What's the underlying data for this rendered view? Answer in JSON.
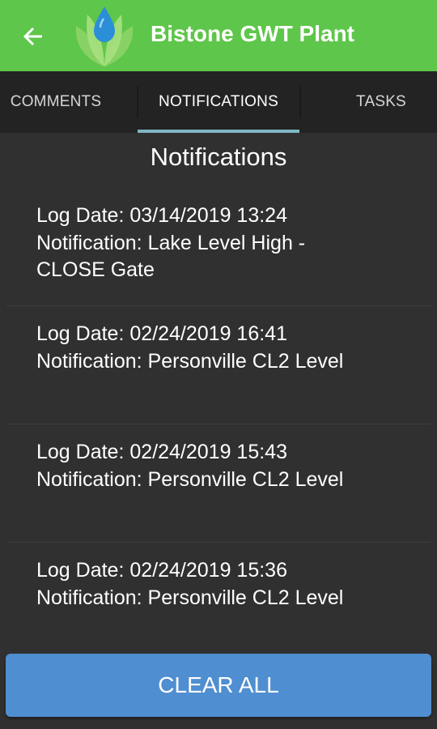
{
  "header": {
    "back_icon": "arrow-left-icon",
    "logo_icon": "water-drop-leaves-logo",
    "title": "Bistone GWT Plant",
    "background_color": "#5ec64a"
  },
  "tabs": [
    {
      "label": "COMMENTS",
      "active": false
    },
    {
      "label": "NOTIFICATIONS",
      "active": true
    },
    {
      "label": "TASKS",
      "active": false
    }
  ],
  "main": {
    "title": "Notifications",
    "notifications": [
      {
        "log_date": "Log Date: 03/14/2019 13:24",
        "notification": "Notification: Lake Level High - CLOSE Gate"
      },
      {
        "log_date": "Log Date: 02/24/2019 16:41",
        "notification": "Notification: Personville CL2 Level"
      },
      {
        "log_date": "Log Date: 02/24/2019 15:43",
        "notification": "Notification: Personville CL2 Level"
      },
      {
        "log_date": "Log Date: 02/24/2019 15:36",
        "notification": "Notification: Personville CL2 Level"
      }
    ]
  },
  "footer": {
    "clear_all_label": "CLEAR ALL",
    "button_color": "#4f8ed0"
  }
}
